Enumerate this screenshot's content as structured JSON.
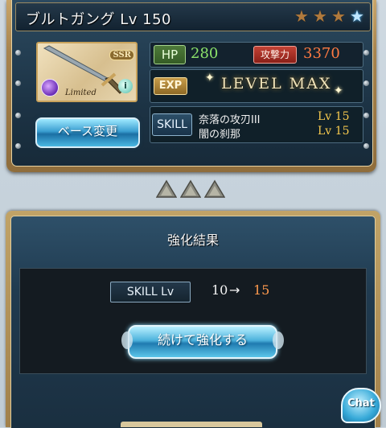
{
  "weapon": {
    "name": "ブルトガング Lv 150",
    "rarity_badge": "SSR",
    "limited_label": "Limited",
    "info_icon": "i",
    "stars": [
      "brown-star",
      "brown-star",
      "brown-star",
      "blue-star"
    ]
  },
  "buttons": {
    "change_base": "ベース変更",
    "continue_upgrade": "続けて強化する",
    "chat": "Chat"
  },
  "stats": {
    "hp_label": "HP",
    "hp_value": "280",
    "atk_label": "攻撃力",
    "atk_value": "3370",
    "exp_label": "EXP",
    "exp_status": "LEVEL MAX",
    "skill_label": "SKILL",
    "skills": [
      {
        "name": "奈落の攻刃III",
        "level": "Lv 15"
      },
      {
        "name": "闇の刹那",
        "level": "Lv 15"
      }
    ]
  },
  "result": {
    "title": "強化結果",
    "skill_lv_label": "SKILL Lv",
    "from_level": "10",
    "arrow": "→",
    "to_level": "15"
  },
  "colors": {
    "hp_value": "#8ce36b",
    "atk_value": "#ff7a42",
    "skill_level": "#f6c94e",
    "to_level": "#ff9a4e"
  }
}
